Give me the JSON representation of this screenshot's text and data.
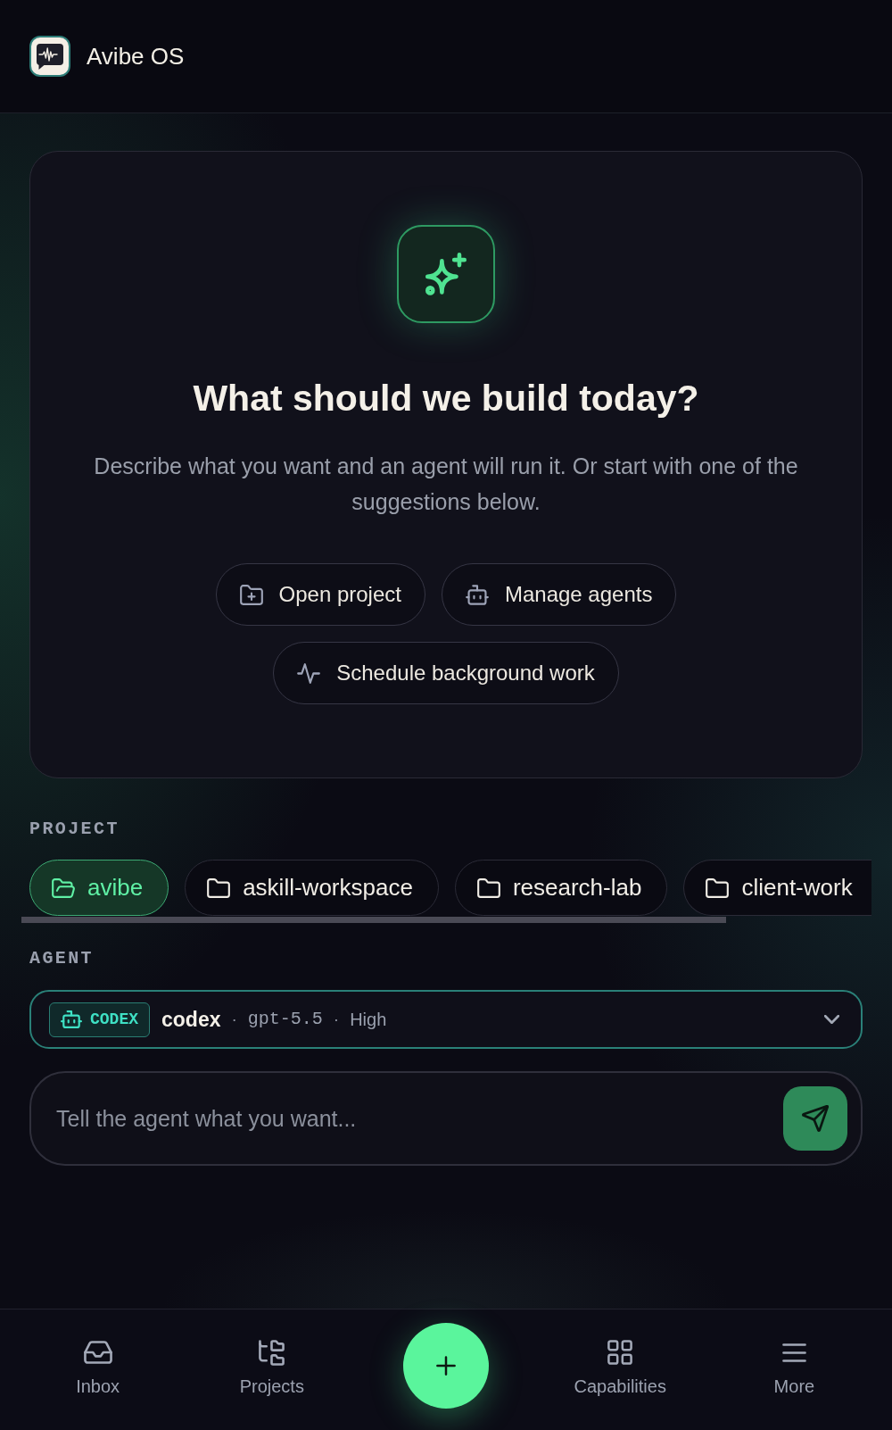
{
  "header": {
    "title": "Avibe OS"
  },
  "hero": {
    "heading": "What should we build today?",
    "description": "Describe what you want and an agent will run it. Or start with one of the suggestions below.",
    "suggestions": [
      {
        "label": "Open project",
        "kind": "project"
      },
      {
        "label": "Manage agents",
        "kind": "agents"
      },
      {
        "label": "Schedule background work",
        "kind": "schedule"
      }
    ]
  },
  "project": {
    "label": "PROJECT",
    "items": [
      {
        "name": "avibe",
        "selected": true
      },
      {
        "name": "askill-workspace",
        "selected": false
      },
      {
        "name": "research-lab",
        "selected": false
      },
      {
        "name": "client-work",
        "selected": false
      }
    ]
  },
  "agent": {
    "label": "AGENT",
    "badge": "CODEX",
    "parts": [
      {
        "text": "codex",
        "kind": "name"
      },
      {
        "text": "·",
        "kind": "separator"
      },
      {
        "text": "gpt-5.5",
        "kind": "model"
      },
      {
        "text": "·",
        "kind": "separator"
      },
      {
        "text": "High",
        "kind": "effort"
      }
    ]
  },
  "composer": {
    "placeholder": "Tell the agent what you want..."
  },
  "bottom_nav": [
    {
      "label": "Inbox",
      "kind": "inbox"
    },
    {
      "label": "Projects",
      "kind": "projects"
    },
    {
      "kind": "create"
    },
    {
      "label": "Capabilities",
      "kind": "capabilities"
    },
    {
      "label": "More",
      "kind": "more"
    }
  ]
}
